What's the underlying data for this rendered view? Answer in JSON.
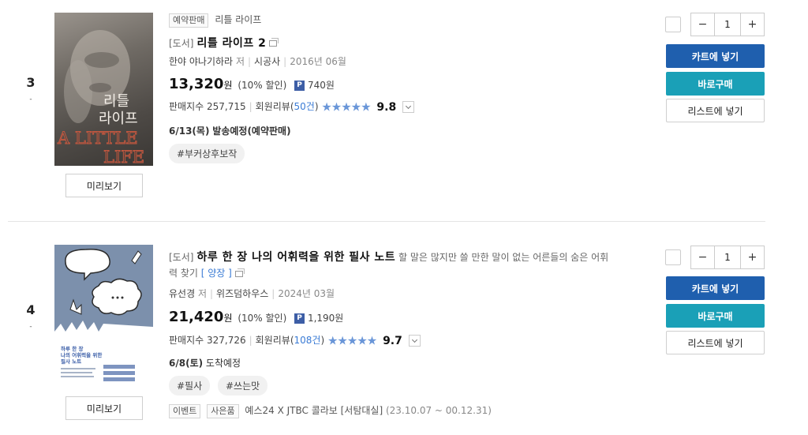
{
  "items": [
    {
      "rank": "3",
      "rank_dash": "-",
      "cover": {
        "title_ko_1": "리틀",
        "title_ko_2": "라이프",
        "title_en_1": "A LITTLE",
        "title_en_2": "LIFE"
      },
      "preview_label": "미리보기",
      "tag_label": "예약판매",
      "series_label": "리틀 라이프",
      "category": "[도서]",
      "title": "리틀 라이프 2",
      "author": "한야 야나기하라",
      "author_suffix": "저",
      "publisher": "시공사",
      "date": "2016년 06월",
      "price": "13,320",
      "won": "원",
      "discount": "(10% 할인)",
      "point_badge": "P",
      "points": "740원",
      "sales_label": "판매지수",
      "sales": "257,715",
      "review_label": "회원리뷰(",
      "review_count": "50건",
      "review_close": ")",
      "stars": "★★★★★",
      "rating": "9.8",
      "ship_date": "6/13(목)",
      "ship_text": "발송예정(예약판매)",
      "hashtags": [
        "#부커상후보작"
      ],
      "qty": "1",
      "cart_label": "카트에 넣기",
      "buy_label": "바로구매",
      "list_label": "리스트에 넣기"
    },
    {
      "rank": "4",
      "rank_dash": "-",
      "cover": {
        "title_1": "하루 한 장",
        "title_2": "나의 어휘력을 위한",
        "title_3": "필사 노트"
      },
      "preview_label": "미리보기",
      "category": "[도서]",
      "title": "하루 한 장 나의 어휘력을 위한 필사 노트",
      "subtitle": "할 말은 많지만 쓸 만한 말이 없는 어른들의 숨은 어휘",
      "subtitle_2": "력 찾기",
      "edition": "[ 양장 ]",
      "author": "유선경",
      "author_suffix": "저",
      "publisher": "위즈덤하우스",
      "date": "2024년 03월",
      "price": "21,420",
      "won": "원",
      "discount": "(10% 할인)",
      "point_badge": "P",
      "points": "1,190원",
      "sales_label": "판매지수",
      "sales": "327,726",
      "review_label": "회원리뷰(",
      "review_count": "108건",
      "review_close": ")",
      "stars": "★★★★★",
      "rating": "9.7",
      "ship_date": "6/8(토)",
      "ship_text": "도착예정",
      "hashtags": [
        "#필사",
        "#쓰는맛"
      ],
      "event_tags": [
        "이벤트",
        "사은품"
      ],
      "event_text": "예스24 X JTBC 콜라보 [서탐대실]",
      "event_period": "(23.10.07 ~ 00.12.31)",
      "qty": "1",
      "cart_label": "카트에 넣기",
      "buy_label": "바로구매",
      "list_label": "리스트에 넣기"
    }
  ],
  "colors": {
    "cart": "#1f5fae",
    "buy": "#1aa0b7",
    "stars": "#6a96d8",
    "link": "#3a7bd5",
    "point_badge": "#3d5ea6"
  }
}
